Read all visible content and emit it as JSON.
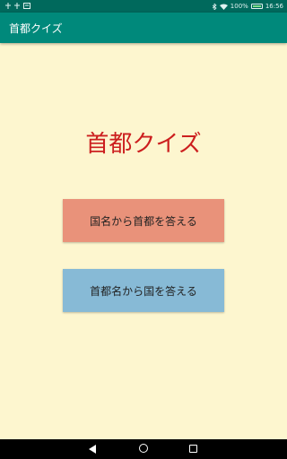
{
  "status_bar": {
    "left_icons": [
      "sim-icon",
      "sim-icon",
      "notification-icon"
    ],
    "battery_percent": "100%",
    "battery_level": 1.0,
    "time": "16:56"
  },
  "app_bar": {
    "title": "首都クイズ"
  },
  "main": {
    "title": "首都クイズ",
    "buttons": [
      {
        "label": "国名から首都を答える",
        "color": "#e9927a"
      },
      {
        "label": "首都名から国を答える",
        "color": "#87bad6"
      }
    ]
  },
  "colors": {
    "status_bar": "#00695c",
    "app_bar": "#00897b",
    "background": "#fdf6cf",
    "title": "#cc1f1f"
  },
  "nav_bar": {
    "icons": [
      "back-icon",
      "home-icon",
      "recent-apps-icon"
    ]
  }
}
